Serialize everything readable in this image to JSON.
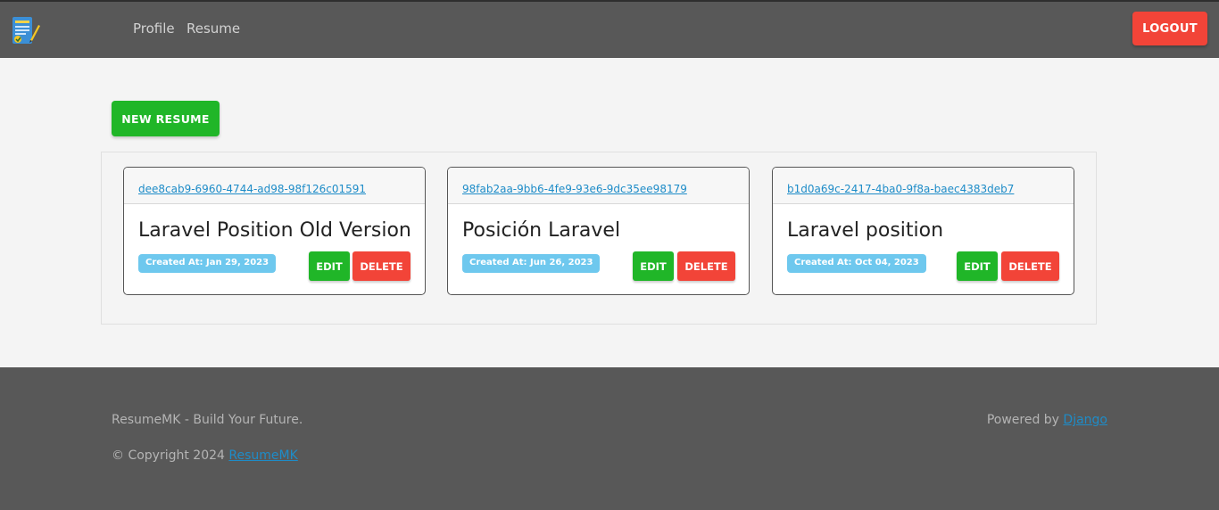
{
  "header": {
    "logo_icon": "resume-pencil-icon",
    "nav": [
      {
        "label": "Profile"
      },
      {
        "label": "Resume"
      }
    ],
    "logout_label": "LOGOUT"
  },
  "main": {
    "new_resume_label": "NEW RESUME",
    "resumes": [
      {
        "id": "dee8cab9-6960-4744-ad98-98f126c01591",
        "title": "Laravel Position Old Version",
        "created": "Created At: Jan 29, 2023",
        "edit_label": "EDIT",
        "delete_label": "DELETE"
      },
      {
        "id": "98fab2aa-9bb6-4fe9-93e6-9dc35ee98179",
        "title": "Posición Laravel",
        "created": "Created At: Jun 26, 2023",
        "edit_label": "EDIT",
        "delete_label": "DELETE"
      },
      {
        "id": "b1d0a69c-2417-4ba0-9f8a-baec4383deb7",
        "title": "Laravel position",
        "created": "Created At: Oct 04, 2023",
        "edit_label": "EDIT",
        "delete_label": "DELETE"
      }
    ]
  },
  "footer": {
    "tagline": "ResumeMK - Build Your Future.",
    "copyright_prefix": "© Copyright 2024 ",
    "copyright_link": "ResumeMK",
    "powered_prefix": "Powered by ",
    "powered_link": "Django"
  },
  "colors": {
    "nav_bg": "#585858",
    "success": "#20b628",
    "danger": "#f24438",
    "info": "#6ec8ee",
    "link": "#1e8cc8"
  }
}
